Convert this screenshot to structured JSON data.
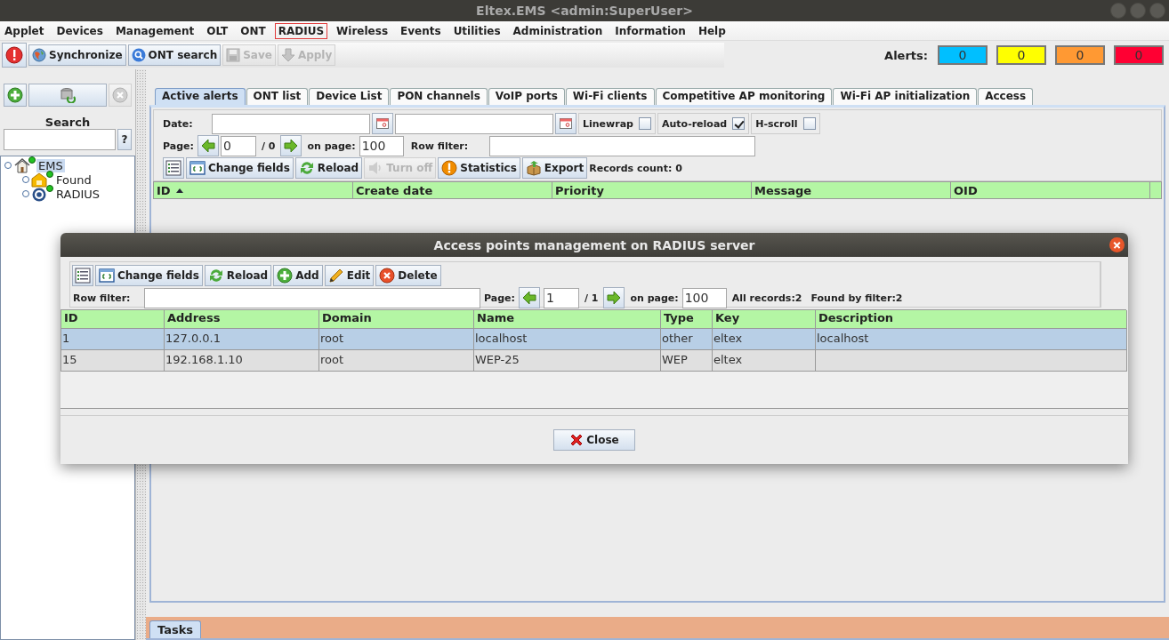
{
  "window": {
    "title": "Eltex.EMS <admin:SuperUser>"
  },
  "menu": [
    {
      "label": "Applet",
      "selected": false
    },
    {
      "label": "Devices",
      "selected": false
    },
    {
      "label": "Management",
      "selected": false
    },
    {
      "label": "OLT",
      "selected": false
    },
    {
      "label": "ONT",
      "selected": false
    },
    {
      "label": "RADIUS",
      "selected": true
    },
    {
      "label": "Wireless",
      "selected": false
    },
    {
      "label": "Events",
      "selected": false
    },
    {
      "label": "Utilities",
      "selected": false
    },
    {
      "label": "Administration",
      "selected": false
    },
    {
      "label": "Information",
      "selected": false
    },
    {
      "label": "Help",
      "selected": false
    }
  ],
  "toolbar": {
    "buttons": [
      {
        "label": "Synchronize",
        "disabled": false
      },
      {
        "label": "ONT search",
        "disabled": false
      },
      {
        "label": "Save",
        "disabled": true
      },
      {
        "label": "Apply",
        "disabled": true
      }
    ]
  },
  "alerts": {
    "label": "Alerts:",
    "counters": [
      {
        "value": "0",
        "color": "#00bfff"
      },
      {
        "value": "0",
        "color": "#ffff00"
      },
      {
        "value": "0",
        "color": "#ff9933"
      },
      {
        "value": "0",
        "color": "#ff0033"
      }
    ]
  },
  "sidebar": {
    "search_label": "Search",
    "help_button": "?",
    "tree": [
      {
        "label": "EMS",
        "kind": "home",
        "selected": true,
        "children": [
          {
            "label": "Found",
            "kind": "group",
            "selected": false
          },
          {
            "label": "RADIUS",
            "kind": "radius",
            "selected": false
          }
        ]
      }
    ]
  },
  "tabs": [
    {
      "label": "Active alerts",
      "selected": true
    },
    {
      "label": "ONT list",
      "selected": false
    },
    {
      "label": "Device List",
      "selected": false
    },
    {
      "label": "PON channels",
      "selected": false
    },
    {
      "label": "VoIP ports",
      "selected": false
    },
    {
      "label": "Wi-Fi clients",
      "selected": false
    },
    {
      "label": "Competitive AP monitoring",
      "selected": false
    },
    {
      "label": "Wi-Fi AP initialization",
      "selected": false
    },
    {
      "label": "Access",
      "selected": false
    }
  ],
  "filters": {
    "date_label": "Date:",
    "options": [
      {
        "label": "Linewrap",
        "checked": false
      },
      {
        "label": "Auto-reload",
        "checked": true
      },
      {
        "label": "H-scroll",
        "checked": false
      }
    ],
    "page_label": "Page:",
    "page_value": "0",
    "page_total": "/ 0",
    "on_page_label": "on page:",
    "on_page_value": "100",
    "row_filter_label": "Row filter:"
  },
  "actions": [
    {
      "label": "Change fields",
      "disabled": false
    },
    {
      "label": "Reload",
      "disabled": false
    },
    {
      "label": "Turn off",
      "disabled": true
    },
    {
      "label": "Statistics",
      "disabled": false
    },
    {
      "label": "Export",
      "disabled": false
    }
  ],
  "records_count": "Records count: 0",
  "table": {
    "columns": [
      {
        "label": "ID",
        "sorted": true
      },
      {
        "label": "Create date",
        "sorted": false
      },
      {
        "label": "Priority",
        "sorted": false
      },
      {
        "label": "Message",
        "sorted": false
      },
      {
        "label": "OID",
        "sorted": false
      }
    ]
  },
  "dialog": {
    "title": "Access points management on RADIUS server",
    "actions": [
      {
        "label": "Change fields"
      },
      {
        "label": "Reload"
      },
      {
        "label": "Add"
      },
      {
        "label": "Edit"
      },
      {
        "label": "Delete"
      }
    ],
    "row_filter_label": "Row filter:",
    "page_label": "Page:",
    "page_value": "1",
    "page_total": "/ 1",
    "on_page_label": "on page:",
    "on_page_value": "100",
    "all_records": "All records:2",
    "found_by_filter": "Found by filter:2",
    "table": {
      "columns": [
        "ID",
        "Address",
        "Domain",
        "Name",
        "Type",
        "Key",
        "Description"
      ],
      "rows": [
        {
          "cells": [
            "1",
            "127.0.0.1",
            "root",
            "localhost",
            "other",
            "eltex",
            "localhost"
          ],
          "selected": true
        },
        {
          "cells": [
            "15",
            "192.168.1.10",
            "root",
            "WEP-25",
            "WEP",
            "eltex",
            ""
          ],
          "selected": false
        }
      ]
    },
    "close_button": "Close"
  },
  "bottom_tabs": [
    {
      "label": "Tasks",
      "selected": true
    }
  ]
}
